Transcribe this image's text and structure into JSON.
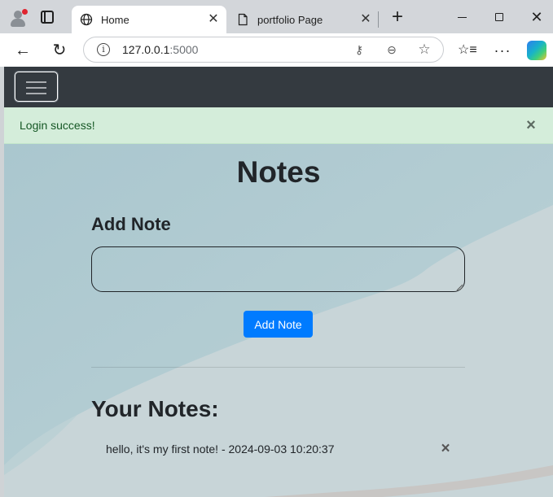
{
  "browser": {
    "tabs": [
      {
        "label": "Home",
        "active": true
      },
      {
        "label": "portfolio Page",
        "active": false
      }
    ],
    "address": {
      "host": "127.0.0.1",
      "port": ":5000"
    },
    "icons": {
      "profile": "profile-avatar-icon",
      "tab_actions": "tab-actions-icon",
      "globe": "globe-icon",
      "page": "page-icon",
      "close": "close-icon",
      "new_tab": "plus-icon",
      "back": "back-arrow-icon",
      "reload": "reload-icon",
      "info": "info-icon",
      "password": "key-icon",
      "zoom": "zoom-out-icon",
      "favorite": "star-icon",
      "favorites": "favorites-icon",
      "more": "more-icon",
      "copilot": "copilot-icon"
    },
    "symbols": {
      "tab_close": "✕",
      "new_tab": "+",
      "window_close": "✕",
      "back": "←",
      "reload": "↻",
      "info": "i",
      "key": "⚷",
      "zoom": "⊖",
      "star": "☆",
      "favorites": "☆≡",
      "more": "···"
    }
  },
  "page": {
    "navbar": {
      "toggler_icon": "hamburger-menu-icon"
    },
    "alert": {
      "message": "Login success!",
      "close_symbol": "×"
    },
    "title": "Notes",
    "add_note": {
      "heading": "Add Note",
      "input_value": "",
      "button_label": "Add Note"
    },
    "your_notes": {
      "heading": "Your Notes:",
      "items": [
        {
          "text": "hello, it's my first note! - 2024-09-03 10:20:37",
          "delete_symbol": "×"
        }
      ]
    },
    "colors": {
      "navbar": "#343a40",
      "alert_bg": "#d4edda",
      "alert_text": "#155724",
      "primary": "#007bff"
    }
  }
}
